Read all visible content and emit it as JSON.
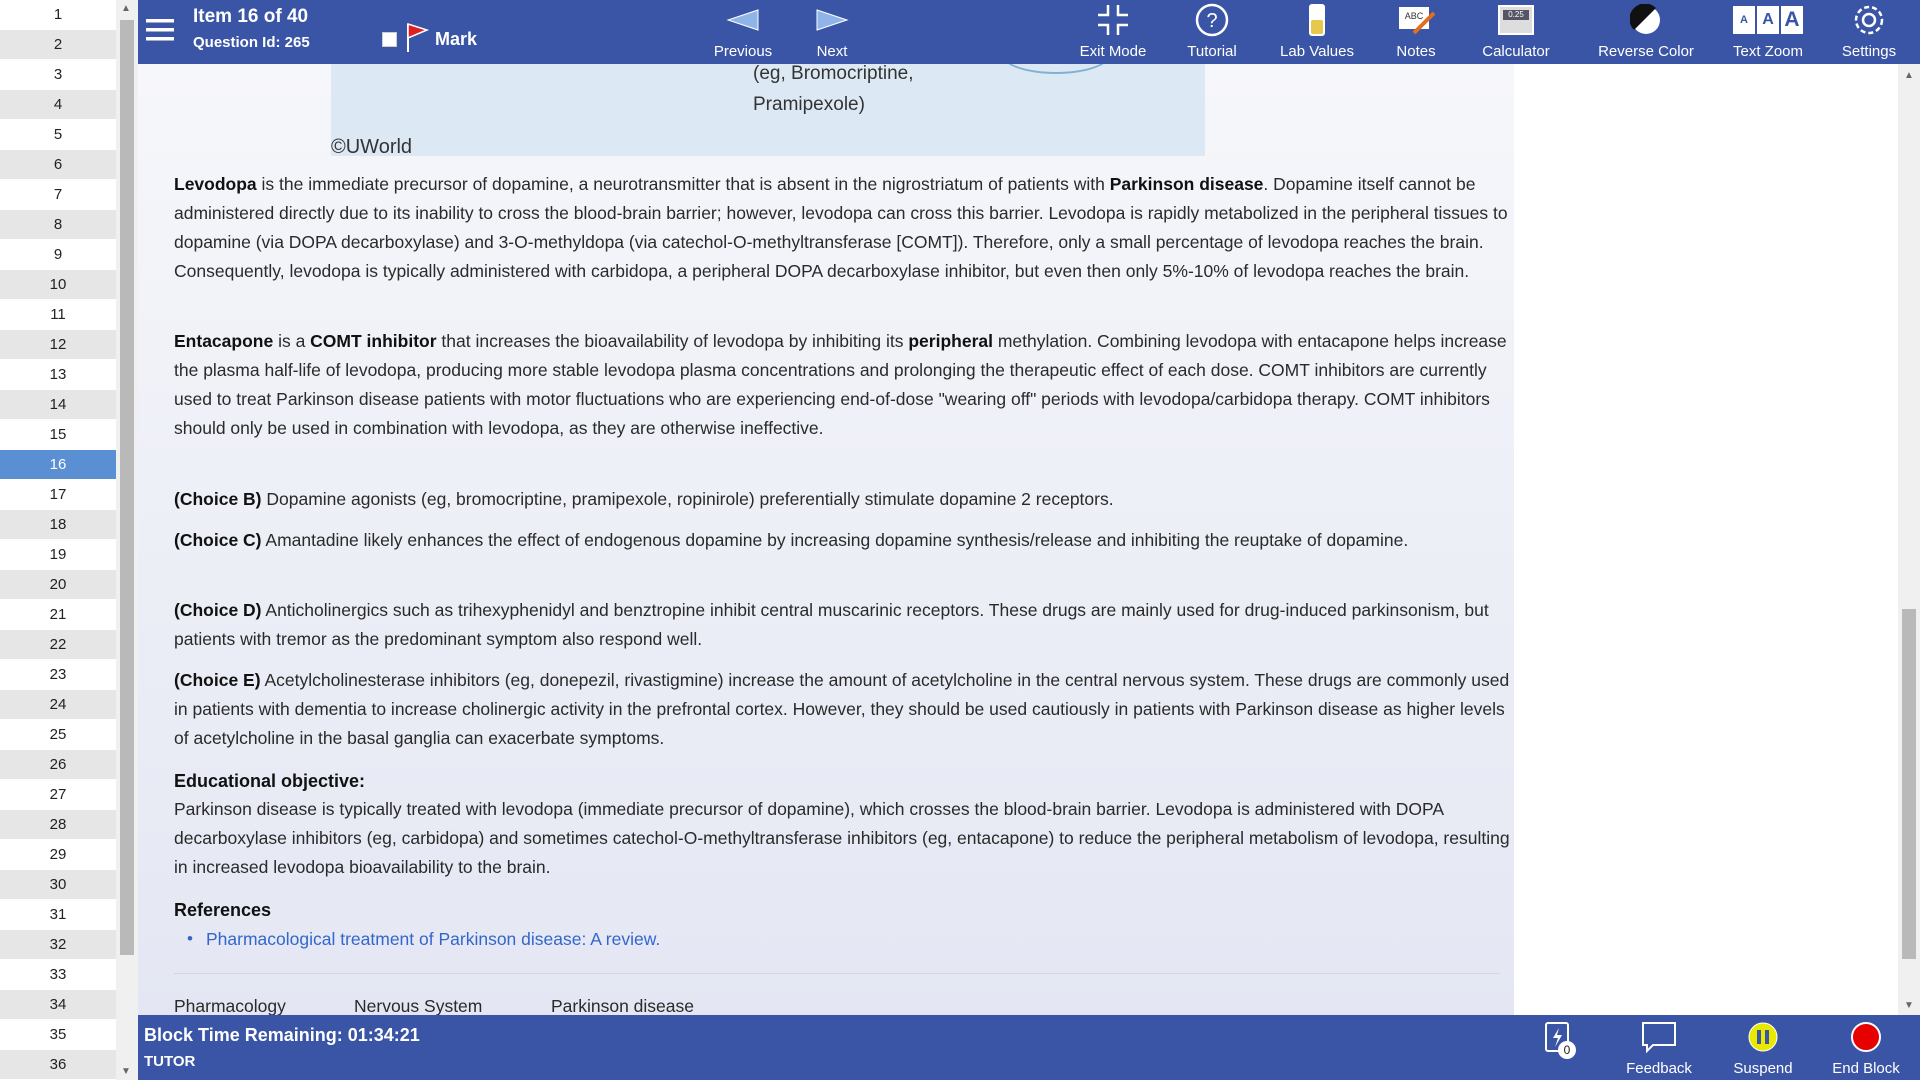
{
  "question_list": {
    "numbers": [
      "1",
      "2",
      "3",
      "4",
      "5",
      "6",
      "7",
      "8",
      "9",
      "10",
      "11",
      "12",
      "13",
      "14",
      "15",
      "16",
      "17",
      "18",
      "19",
      "20",
      "21",
      "22",
      "23",
      "24",
      "25",
      "26",
      "27",
      "28",
      "29",
      "30",
      "31",
      "32",
      "33",
      "34",
      "35",
      "36"
    ],
    "active": "16"
  },
  "header": {
    "item_label": "Item 16 of 40",
    "question_id": "Question Id: 265",
    "mark_label": "Mark",
    "previous_label": "Previous",
    "next_label": "Next",
    "exit_mode_label": "Exit Mode",
    "tutorial_label": "Tutorial",
    "lab_values_label": "Lab Values",
    "notes_label": "Notes",
    "calculator_label": "Calculator",
    "calculator_display": "0.25",
    "reverse_color_label": "Reverse Color",
    "text_zoom_label": "Text Zoom",
    "settings_label": "Settings"
  },
  "figure": {
    "line1": "(eg, Bromocriptine,",
    "line2": "Pramipexole)",
    "copyright": "©UWorld"
  },
  "explanation": {
    "p1_b1": "Levodopa",
    "p1_t1": " is the immediate precursor of dopamine, a neurotransmitter that is absent in the nigrostriatum of patients with ",
    "p1_b2": "Parkinson disease",
    "p1_t2": ".  Dopamine itself cannot be administered directly due to its inability to cross the blood-brain barrier; however, levodopa can cross this barrier.  Levodopa is rapidly metabolized in the peripheral tissues to dopamine (via DOPA decarboxylase) and 3-O-methyldopa (via catechol-O-methyltransferase [COMT]).  Therefore, only a small percentage of levodopa reaches the brain.  Consequently, levodopa is typically administered with carbidopa, a peripheral DOPA decarboxylase inhibitor, but even then only 5%-10% of levodopa reaches the brain.",
    "p2_b1": "Entacapone",
    "p2_t1": " is a ",
    "p2_b2": "COMT inhibitor",
    "p2_t2": " that increases the bioavailability of levodopa by inhibiting its ",
    "p2_b3": "peripheral",
    "p2_t3": " methylation.  Combining levodopa with entacapone helps increase the plasma half-life of levodopa, producing more stable levodopa plasma concentrations and prolonging the therapeutic effect of each dose.  COMT inhibitors are currently used to treat Parkinson disease patients with motor fluctuations who are experiencing end-of-dose \"wearing off\" periods with levodopa/carbidopa therapy.  COMT inhibitors should only be used in combination with levodopa, as they are otherwise ineffective.",
    "choices": [
      {
        "label": "(Choice B)",
        "text": "  Dopamine agonists (eg, bromocriptine, pramipexole, ropinirole) preferentially stimulate dopamine 2 receptors."
      },
      {
        "label": "(Choice C)",
        "text": "  Amantadine likely enhances the effect of endogenous dopamine by increasing dopamine synthesis/release and inhibiting the reuptake of dopamine."
      },
      {
        "label": "(Choice D)",
        "text": "  Anticholinergics such as trihexyphenidyl and benztropine inhibit central muscarinic receptors.  These drugs are mainly used for drug-induced parkinsonism, but patients with tremor as the predominant symptom also respond well."
      },
      {
        "label": "(Choice E)",
        "text": "  Acetylcholinesterase inhibitors (eg, donepezil, rivastigmine) increase the amount of acetylcholine in the central nervous system.  These drugs are commonly used in patients with dementia to increase cholinergic activity in the prefrontal cortex.  However, they should be used cautiously in patients with Parkinson disease as higher levels of acetylcholine in the basal ganglia can exacerbate symptoms."
      }
    ],
    "edu_heading": "Educational objective:",
    "edu_text": "Parkinson disease is typically treated with levodopa (immediate precursor of dopamine), which crosses the blood-brain barrier.  Levodopa is administered with DOPA decarboxylase inhibitors (eg, carbidopa) and sometimes catechol-O-methyltransferase inhibitors (eg, entacapone) to reduce the peripheral metabolism of levodopa, resulting in increased levodopa bioavailability to the brain.",
    "references_heading": "References",
    "reference_link": "Pharmacological treatment of Parkinson disease: A review.",
    "tags": [
      "Pharmacology",
      "Nervous System",
      "Parkinson disease"
    ]
  },
  "footer": {
    "block_time": "Block Time Remaining: 01:34:21",
    "mode": "TUTOR",
    "flash_count": "0",
    "feedback_label": "Feedback",
    "suspend_label": "Suspend",
    "end_block_label": "End Block"
  },
  "colors": {
    "toolbar": "#3b55a6",
    "active_item": "#5b8fd3",
    "link": "#3366cc",
    "end_block": "#e60000",
    "suspend": "#e8e800"
  }
}
